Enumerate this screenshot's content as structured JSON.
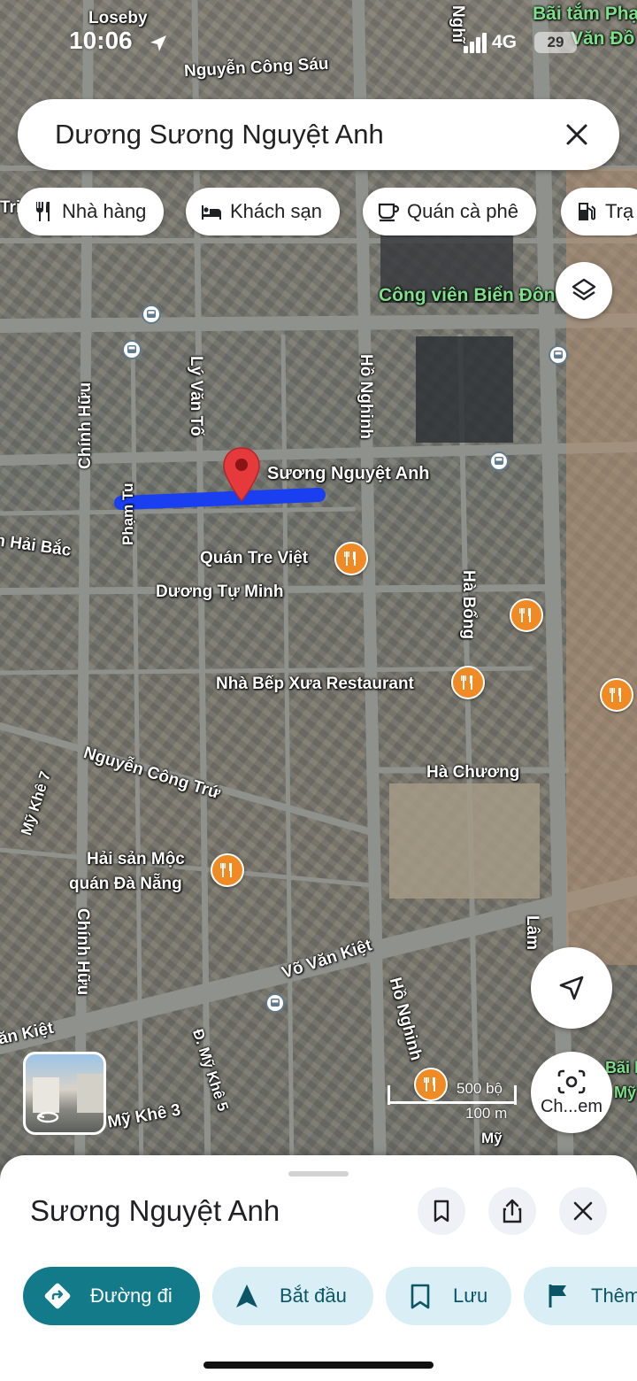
{
  "status_bar": {
    "time": "10:06",
    "network": "4G",
    "battery": "29"
  },
  "search": {
    "query": "Dương Sương Nguyệt Anh"
  },
  "chips": [
    {
      "label": "Nhà hàng",
      "icon": "fork-knife-icon"
    },
    {
      "label": "Khách sạn",
      "icon": "bed-icon"
    },
    {
      "label": "Quán cà phê",
      "icon": "coffee-cup-icon"
    },
    {
      "label": "Trạ",
      "icon": "gas-station-icon"
    }
  ],
  "map": {
    "labels": {
      "loseby": "Loseby",
      "bai_tam_1": "Bãi tắm Phạ",
      "bai_tam_2": "Văn Đồ",
      "nguyen_cong_sau": "Nguyễn Công Sáu",
      "nghia_partial": "Nghĩ",
      "tri_partial": "Tri",
      "cong_vien": "Công viên Biển Đôn",
      "chinh_huu_top": "Chính Hữu",
      "ly_van_to": "Lý Văn Tố",
      "ho_nghinh_top": "Hồ Nghinh",
      "suong_nguyet_anh": "Sương Nguyệt Anh",
      "pham_tu": "Phạm Tu",
      "hai_bac": "n Hải Bắc",
      "quan_tre_viet": "Quán Tre Việt",
      "duong_tu_minh": "Dương Tự Minh",
      "ha_bong": "Hà Bổng",
      "nha_bep_xua": "Nhà Bếp Xưa Restaurant",
      "ha_chuong": "Hà Chương",
      "nguyen_cong_tru": "Nguyễn Công Trứ",
      "my_khe_7": "Mỹ Khê 7",
      "hai_san_moc_1": "Hải sản Mộc",
      "hai_san_moc_2": "quán Đà Nẵng",
      "chinh_huu_bottom": "Chính Hữu",
      "vo_van_kiet": "Võ Văn Kiệt",
      "ho_nghinh_bottom": "Hồ Nghinh",
      "lam_partial": "Lâm",
      "an_kiet": "ăn Kiệt",
      "d_my_khe_5": "Đ. Mỹ Khê 5",
      "my_khe_3": "Mỹ Khê 3",
      "bai_partial_1": "Bãi b",
      "bai_partial_2": "Mỹ",
      "my_partial": "Mỹ"
    },
    "scale": {
      "imperial": "500 bộ",
      "metric": "100 m"
    },
    "camera_button_label": "Ch...em"
  },
  "sheet": {
    "title": "Sương Nguyệt Anh",
    "actions": [
      {
        "label": "Đường đi",
        "icon": "directions-icon"
      },
      {
        "label": "Bắt đầu",
        "icon": "navigation-arrow-icon"
      },
      {
        "label": "Lưu",
        "icon": "bookmark-icon"
      },
      {
        "label": "Thêm",
        "icon": "flag-icon"
      }
    ]
  },
  "colors": {
    "accent": "#137a8a",
    "route": "#1a3ff0",
    "pin": "#e5393b",
    "poi": "#f08a24",
    "chip_bg": "#ffffff"
  }
}
